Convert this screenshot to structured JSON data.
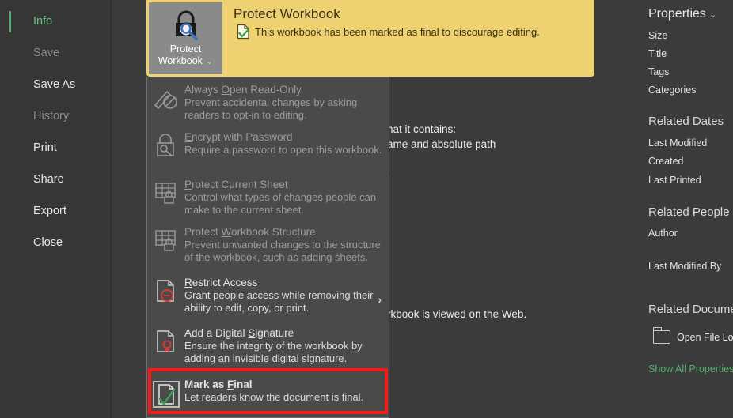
{
  "app": {
    "background_color": "#3b3b3b",
    "accent_green": "#55b06d",
    "banner_yellow": "#eed170",
    "highlight_red": "#f51919"
  },
  "sidebar": {
    "items": [
      {
        "label": "Info",
        "state": "selected"
      },
      {
        "label": "Save",
        "state": "disabled"
      },
      {
        "label": "Save As",
        "state": "normal"
      },
      {
        "label": "History",
        "state": "disabled"
      },
      {
        "label": "Print",
        "state": "normal"
      },
      {
        "label": "Share",
        "state": "normal"
      },
      {
        "label": "Export",
        "state": "normal"
      },
      {
        "label": "Close",
        "state": "normal"
      }
    ]
  },
  "banner": {
    "button_label_line1": "Protect",
    "button_label_line2": "Workbook",
    "button_caret": "⌄",
    "title": "Protect Workbook",
    "description": "This workbook has been marked as final to discourage editing."
  },
  "dropdown": {
    "items": [
      {
        "icon": "pencil-no-edit-icon",
        "title_pre": "Always ",
        "title_key": "O",
        "title_post": "pen Read-Only",
        "desc": "Prevent accidental changes by asking readers to opt-in to editing.",
        "state": "disabled",
        "submenu": false
      },
      {
        "icon": "lock-key-icon",
        "title_pre": "",
        "title_key": "E",
        "title_post": "ncrypt with Password",
        "desc": "Require a password to open this workbook.",
        "state": "disabled",
        "submenu": false
      },
      {
        "icon": "sheet-lock-icon",
        "title_pre": "",
        "title_key": "P",
        "title_post": "rotect Current Sheet",
        "desc": "Control what types of changes people can make to the current sheet.",
        "state": "disabled",
        "submenu": false
      },
      {
        "icon": "workbook-structure-lock-icon",
        "title_pre": "Protect ",
        "title_key": "W",
        "title_post": "orkbook Structure",
        "desc": "Prevent unwanted changes to the structure of the workbook, such as adding sheets.",
        "state": "disabled",
        "submenu": false
      },
      {
        "icon": "restrict-access-icon",
        "title_pre": "",
        "title_key": "R",
        "title_post": "estrict Access",
        "desc": "Grant people access while removing their ability to edit, copy, or print.",
        "state": "normal",
        "submenu": true,
        "submenu_glyph": "›"
      },
      {
        "icon": "digital-signature-icon",
        "title_pre": "Add a Digital ",
        "title_key": "S",
        "title_post": "ignature",
        "desc": "Ensure the integrity of the workbook by adding an invisible digital signature.",
        "state": "normal",
        "submenu": false
      },
      {
        "icon": "mark-as-final-icon",
        "title_pre": "Mark as ",
        "title_key": "F",
        "title_post": "inal",
        "desc": "Let readers know the document is final.",
        "state": "highlighted",
        "submenu": false
      }
    ]
  },
  "body_text": {
    "line1": "hat it contains:",
    "line2": "ame and absolute path",
    "line3": "rkbook is viewed on the Web."
  },
  "properties": {
    "header": "Properties",
    "header_caret": "⌄",
    "fields": [
      "Size",
      "Title",
      "Tags",
      "Categories"
    ],
    "groups": [
      {
        "title": "Related Dates",
        "fields": [
          "Last Modified",
          "Created",
          "Last Printed"
        ]
      },
      {
        "title": "Related People",
        "fields": [
          "Author",
          "Last Modified By"
        ]
      },
      {
        "title": "Related Docume",
        "fields": []
      }
    ],
    "open_file_location": "Open File Loc",
    "show_all_properties": "Show All Properties"
  }
}
